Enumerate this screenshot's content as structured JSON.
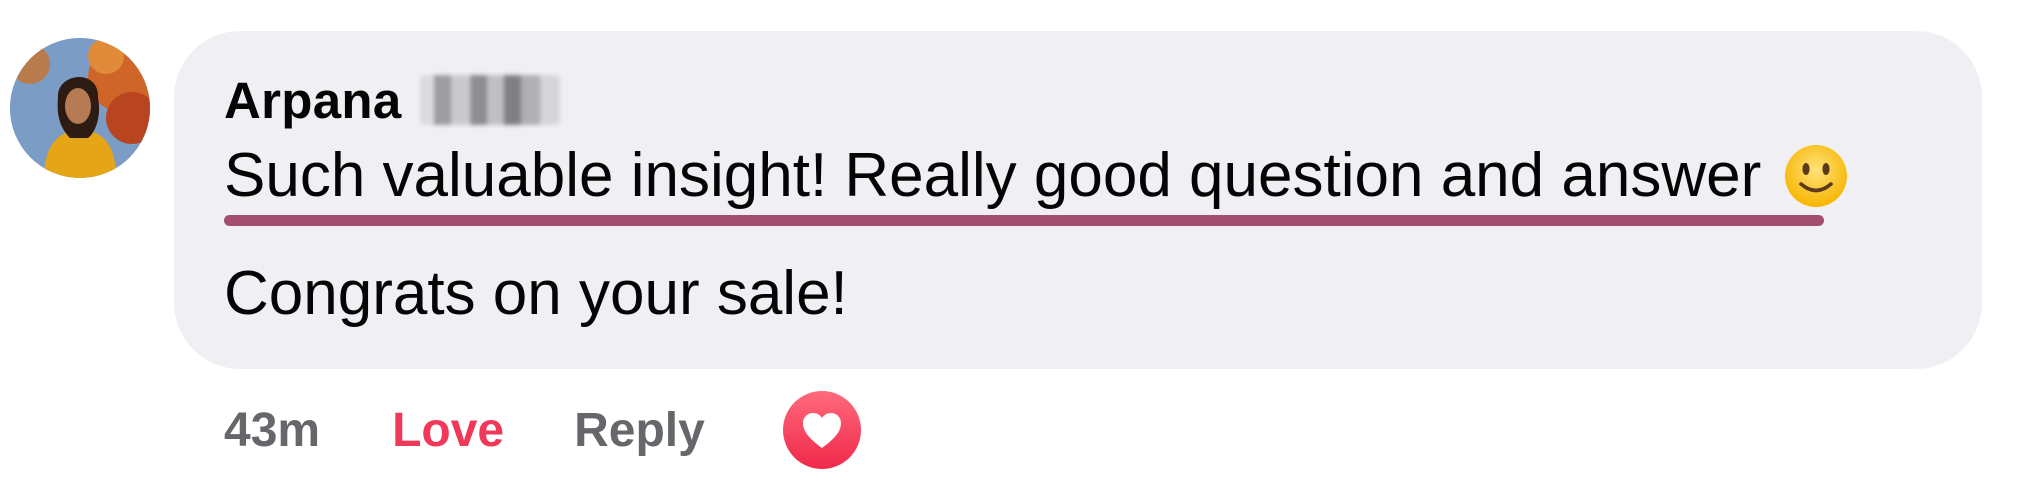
{
  "comment": {
    "author": {
      "name": "Arpana",
      "avatar_icon": "user-avatar-photo"
    },
    "text_line1": "Such valuable insight! Really good question and answer",
    "emoji_icon": "slightly-smiling-face-emoji",
    "text_line2": "Congrats on your sale!",
    "highlight_color": "#a54f6f",
    "bubble_color": "#f0f0f4"
  },
  "actions": {
    "timestamp": "43m",
    "love_label": "Love",
    "love_color": "#f0395a",
    "reply_label": "Reply",
    "reaction_icon": "heart-reaction-icon"
  }
}
